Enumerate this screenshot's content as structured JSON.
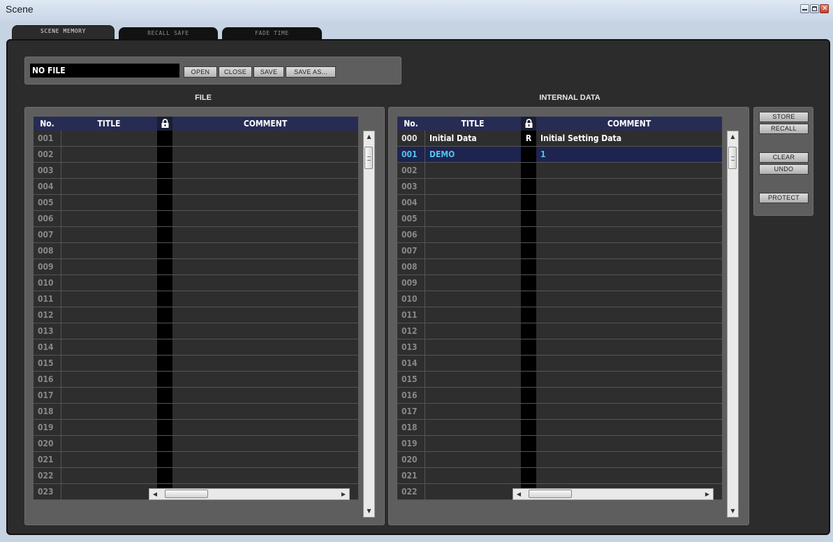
{
  "window": {
    "title": "Scene"
  },
  "tabs": [
    {
      "label": "SCENE MEMORY",
      "active": true
    },
    {
      "label": "RECALL SAFE",
      "active": false
    },
    {
      "label": "FADE TIME",
      "active": false
    }
  ],
  "file": {
    "filename": "NO FILE",
    "buttons": {
      "open": "OPEN",
      "close": "CLOSE",
      "save": "SAVE",
      "save_as": "SAVE AS..."
    }
  },
  "sections": {
    "file": "FILE",
    "internal": "INTERNAL DATA"
  },
  "columns": {
    "no": "No.",
    "title": "TITLE",
    "comment": "COMMENT"
  },
  "file_rows": [
    {
      "no": "001"
    },
    {
      "no": "002"
    },
    {
      "no": "003"
    },
    {
      "no": "004"
    },
    {
      "no": "005"
    },
    {
      "no": "006"
    },
    {
      "no": "007"
    },
    {
      "no": "008"
    },
    {
      "no": "009"
    },
    {
      "no": "010"
    },
    {
      "no": "011"
    },
    {
      "no": "012"
    },
    {
      "no": "013"
    },
    {
      "no": "014"
    },
    {
      "no": "015"
    },
    {
      "no": "016"
    },
    {
      "no": "017"
    },
    {
      "no": "018"
    },
    {
      "no": "019"
    },
    {
      "no": "020"
    },
    {
      "no": "021"
    },
    {
      "no": "022"
    },
    {
      "no": "023"
    }
  ],
  "internal_rows": [
    {
      "no": "000",
      "title": "Initial Data",
      "lock": "R",
      "comment": "Initial Setting Data",
      "header": true
    },
    {
      "no": "001",
      "title": "DEMO",
      "lock": "",
      "comment": "1",
      "selected": true
    },
    {
      "no": "002"
    },
    {
      "no": "003"
    },
    {
      "no": "004"
    },
    {
      "no": "005"
    },
    {
      "no": "006"
    },
    {
      "no": "007"
    },
    {
      "no": "008"
    },
    {
      "no": "009"
    },
    {
      "no": "010"
    },
    {
      "no": "011"
    },
    {
      "no": "012"
    },
    {
      "no": "013"
    },
    {
      "no": "014"
    },
    {
      "no": "015"
    },
    {
      "no": "016"
    },
    {
      "no": "017"
    },
    {
      "no": "018"
    },
    {
      "no": "019"
    },
    {
      "no": "020"
    },
    {
      "no": "021"
    },
    {
      "no": "022"
    }
  ],
  "actions": {
    "store": "STORE",
    "recall": "RECALL",
    "clear": "CLEAR",
    "undo": "UNDO",
    "protect": "PROTECT"
  },
  "colors": {
    "header_bg": "#272c55",
    "selected_text": "#4fc3ef",
    "selected_bg": "#1e2450"
  }
}
